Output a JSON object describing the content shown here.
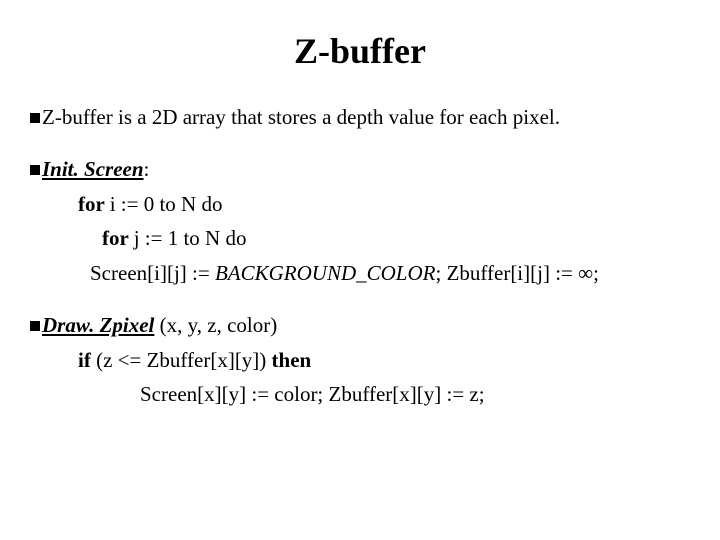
{
  "title": "Z-buffer",
  "def": "Z-buffer is a 2D array that stores a depth value for each pixel.",
  "init": {
    "label": "Init. Screen",
    "colon": ":",
    "for_i_prefix": "for ",
    "for_i_rest": "i := 0 to N do",
    "for_j_prefix": "for ",
    "for_j_rest": "j := 1 to N do",
    "body_prefix": "Screen[i][j] := ",
    "bg": "BACKGROUND_COLOR",
    "body_mid": ";  Zbuffer[i][j] := ",
    "inf": "∞",
    "body_end": ";"
  },
  "draw": {
    "label": "Draw. Zpixel",
    "args": " (x, y, z, color)",
    "if_prefix": "if ",
    "if_cond": "(z <= Zbuffer[x][y]) ",
    "if_then": "then",
    "body": "Screen[x][y] := color; Zbuffer[x][y] := z;"
  }
}
